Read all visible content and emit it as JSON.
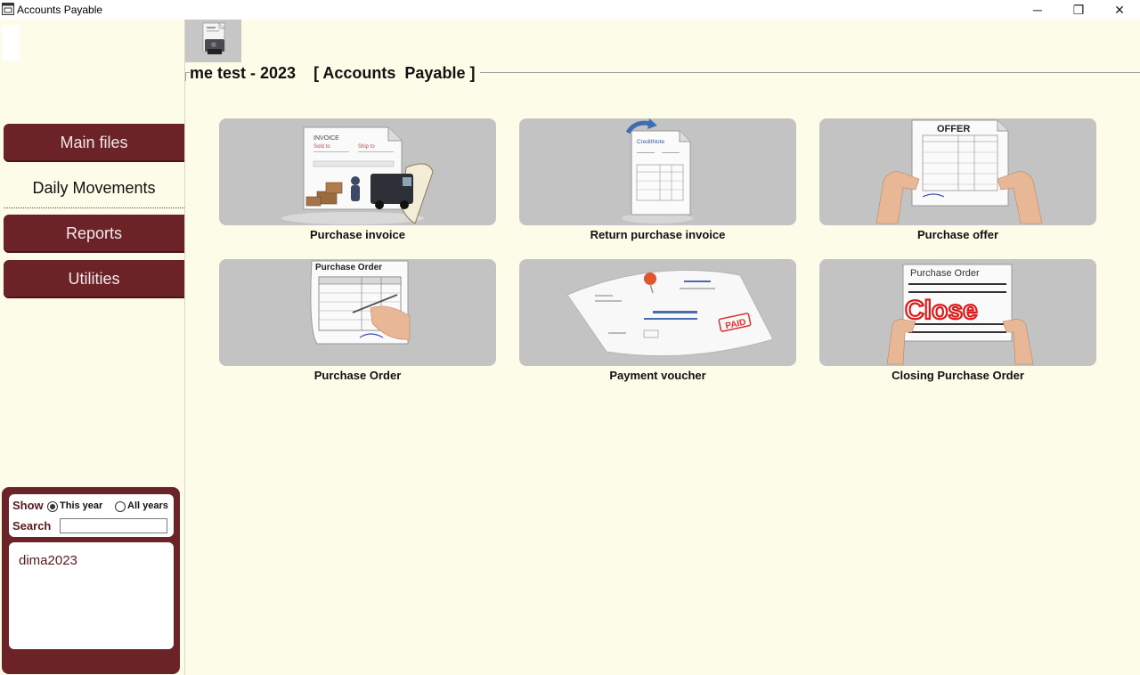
{
  "window": {
    "title": "Accounts  Payable",
    "minimize_glyph": "─",
    "restore_glyph": "❐",
    "close_glyph": "✕"
  },
  "header": {
    "company_title": "me test - 2023    [ Accounts  Payable ]"
  },
  "sidebar": {
    "nav": [
      {
        "label": "Main files"
      },
      {
        "label": "Daily Movements"
      },
      {
        "label": "Reports"
      },
      {
        "label": "Utilities"
      }
    ]
  },
  "filter": {
    "show_label": "Show",
    "option_this_year": "This year",
    "option_all_years": "All years",
    "selected": "This year",
    "search_label": "Search",
    "search_value": "",
    "items": [
      "dima2023"
    ]
  },
  "tiles": [
    {
      "label": "Purchase invoice",
      "icon": "invoice-truck-icon"
    },
    {
      "label": "Return purchase invoice",
      "icon": "credit-note-icon"
    },
    {
      "label": "Purchase offer",
      "icon": "offer-sheet-icon"
    },
    {
      "label": "Purchase Order",
      "icon": "purchase-order-sign-icon"
    },
    {
      "label": "Payment voucher",
      "icon": "pinned-paid-voucher-icon"
    },
    {
      "label": "Closing Purchase Order",
      "icon": "close-purchase-order-icon"
    }
  ],
  "art_text": {
    "invoice": "INVOICE",
    "sold_to": "Sold to",
    "ship_to": "Ship to",
    "credit_note": "CreditNote",
    "offer": "OFFER",
    "purchase_order": "Purchase Order",
    "paid": "PAID",
    "po_title": "Purchase  Order",
    "close": "Close"
  },
  "colors": {
    "brand": "#6b2328",
    "background": "#fdfce9",
    "tile": "#c3c3c3",
    "close_red": "#e01818"
  }
}
